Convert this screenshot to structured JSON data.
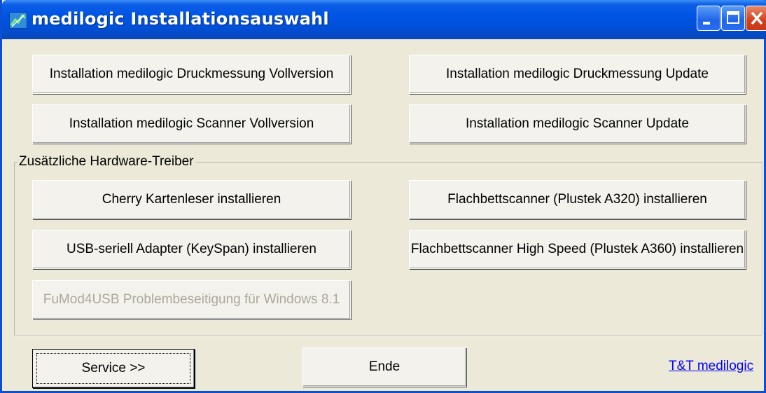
{
  "window": {
    "title": "medilogic Installationsauswahl"
  },
  "titlebar_icons": {
    "app": "app-icon",
    "minimize": "minimize-icon",
    "maximize": "maximize-icon",
    "close": "close-icon"
  },
  "buttons": {
    "druck_voll": "Installation medilogic Druckmessung Vollversion",
    "druck_update": "Installation medilogic Druckmessung Update",
    "scanner_voll": "Installation medilogic Scanner Vollversion",
    "scanner_update": "Installation medilogic Scanner Update"
  },
  "hardware": {
    "group_label": "Zusätzliche Hardware-Treiber",
    "cherry": "Cherry Kartenleser installieren",
    "plustek_a320": "Flachbettscanner (Plustek A320) installieren",
    "keyspan": "USB-seriell Adapter (KeySpan) installieren",
    "plustek_a360": "Flachbettscanner High Speed (Plustek A360) installieren",
    "fumod": "FuMod4USB Problembeseitigung für Windows 8.1"
  },
  "footer": {
    "service": "Service >>",
    "ende": "Ende",
    "link": "T&T medilogic"
  },
  "colors": {
    "titlebar": "#0054e3",
    "face": "#ece9d8",
    "link": "#0000ff",
    "disabled_text": "#aca899"
  }
}
